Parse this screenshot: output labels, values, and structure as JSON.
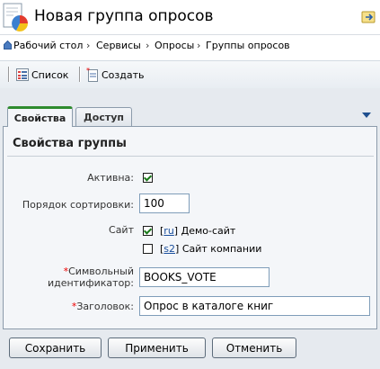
{
  "header": {
    "title": "Новая группа опросов",
    "page_icon": "poll-group-icon",
    "help_icon": "help-icon"
  },
  "breadcrumb": {
    "items": [
      "Рабочий стол",
      "Сервисы",
      "Опросы",
      "Группы опросов"
    ],
    "separator": "›"
  },
  "toolbar": {
    "list_label": "Список",
    "create_label": "Создать"
  },
  "tabs": [
    {
      "label": "Свойства",
      "active": true
    },
    {
      "label": "Доступ",
      "active": false
    }
  ],
  "form": {
    "section_title": "Свойства группы",
    "active_label": "Активна:",
    "active_checked": true,
    "sort_label": "Порядок сортировки:",
    "sort_value": "100",
    "site_label": "Сайт",
    "sites": [
      {
        "code": "ru",
        "name": "Демо-сайт",
        "checked": true
      },
      {
        "code": "s2",
        "name": "Сайт компании",
        "checked": false
      }
    ],
    "symbolic_id_label_1": "Символьный",
    "symbolic_id_label_2": "идентификатор:",
    "symbolic_id_value": "BOOKS_VOTE",
    "heading_label": "Заголовок:",
    "heading_value": "Опрос в каталоге книг",
    "required_mark": "*"
  },
  "buttons": {
    "save": "Сохранить",
    "apply": "Применить",
    "cancel": "Отменить"
  },
  "colors": {
    "active_tab_accent": "#2e8b2e",
    "required": "#ee0000",
    "link": "#1b4f9c"
  }
}
